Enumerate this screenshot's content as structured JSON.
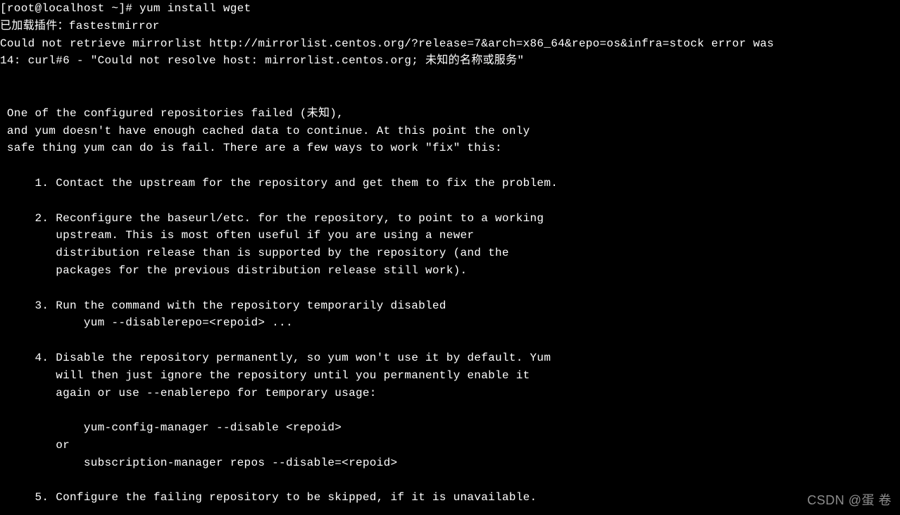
{
  "prompt": {
    "user_host": "[root@localhost ~]#",
    "command": "yum install wget"
  },
  "lines": {
    "plugin_loaded": "已加载插件：fastestmirror",
    "error1": "Could not retrieve mirrorlist http://mirrorlist.centos.org/?release=7&arch=x86_64&repo=os&infra=stock error was",
    "error2": "14: curl#6 - \"Could not resolve host: mirrorlist.centos.org; 未知的名称或服务\"",
    "blank": "",
    "msg1": " One of the configured repositories failed (未知),",
    "msg2": " and yum doesn't have enough cached data to continue. At this point the only",
    "msg3": " safe thing yum can do is fail. There are a few ways to work \"fix\" this:",
    "item1": "     1. Contact the upstream for the repository and get them to fix the problem.",
    "item2a": "     2. Reconfigure the baseurl/etc. for the repository, to point to a working",
    "item2b": "        upstream. This is most often useful if you are using a newer",
    "item2c": "        distribution release than is supported by the repository (and the",
    "item2d": "        packages for the previous distribution release still work).",
    "item3a": "     3. Run the command with the repository temporarily disabled",
    "item3b": "            yum --disablerepo=<repoid> ...",
    "item4a": "     4. Disable the repository permanently, so yum won't use it by default. Yum",
    "item4b": "        will then just ignore the repository until you permanently enable it",
    "item4c": "        again or use --enablerepo for temporary usage:",
    "item4d": "            yum-config-manager --disable <repoid>",
    "item4e": "        or",
    "item4f": "            subscription-manager repos --disable=<repoid>",
    "item5": "     5. Configure the failing repository to be skipped, if it is unavailable."
  },
  "watermark": "CSDN @蛋 卷"
}
